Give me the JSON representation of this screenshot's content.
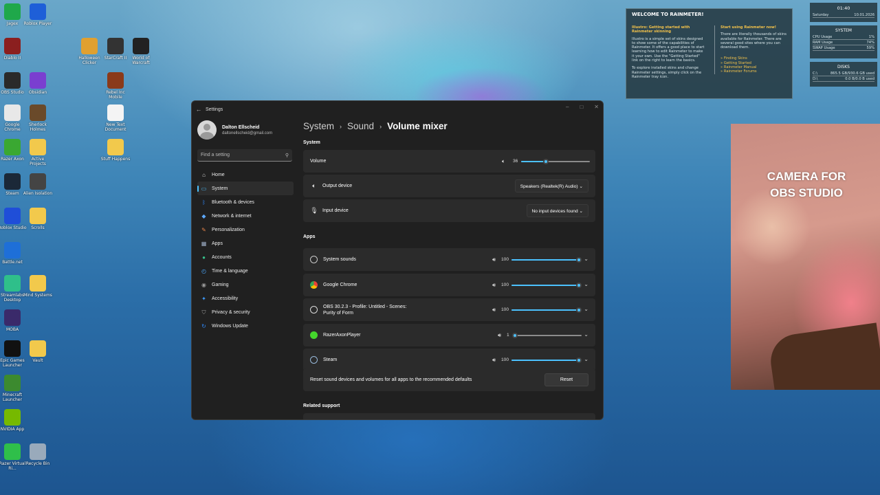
{
  "desktop": {
    "icons": [
      {
        "label": "Jagex"
      },
      {
        "label": "Roblox Player"
      },
      {
        "label": "Diablo II"
      },
      {
        "label": "Halloween Clicker"
      },
      {
        "label": "StarCraft II"
      },
      {
        "label": "World of Warcraft"
      },
      {
        "label": "OBS Studio"
      },
      {
        "label": "Obsidian"
      },
      {
        "label": "Rebel Inc Mobile"
      },
      {
        "label": "Google Chrome"
      },
      {
        "label": "Sherlock Holmes"
      },
      {
        "label": "New Text Document"
      },
      {
        "label": "Razer Axon"
      },
      {
        "label": "Active Projects"
      },
      {
        "label": "Stuff Happens"
      },
      {
        "label": "Steam"
      },
      {
        "label": "Alien Isolation"
      },
      {
        "label": "Roblox Studio"
      },
      {
        "label": "Scrolls"
      },
      {
        "label": "Battle.net"
      },
      {
        "label": "Streamlabs Desktop"
      },
      {
        "label": "Mind Systems"
      },
      {
        "label": "MOBA"
      },
      {
        "label": "Epic Games Launcher"
      },
      {
        "label": "Vault"
      },
      {
        "label": "Minecraft Launcher"
      },
      {
        "label": "NVIDIA App"
      },
      {
        "label": "Razer Virtual Ri..."
      },
      {
        "label": "Recycle Bin"
      }
    ]
  },
  "rainmeter": {
    "welcome_title": "WELCOME TO RAINMETER!",
    "left_heading": "Illustro: Getting started with Rainmeter skinning",
    "left_body": "Illustro is a simple set of skins designed to show some of the capabilities of Rainmeter. It offers a good place to start learning how to edit Rainmeter to make it your own. Use the \"Getting Started\" link on the right to learn the basics.",
    "left_body2": "To explore installed skins and change Rainmeter settings, simply click on the Rainmeter tray icon.",
    "right_heading": "Start using Rainmeter now!",
    "right_body": "There are literally thousands of skins available for Rainmeter. There are several good sites where you can download them.",
    "links": [
      "» Finding Skins",
      "» Getting Started",
      "» Rainmeter Manual",
      "» Rainmeter Forums"
    ],
    "clock": {
      "time": "01:40",
      "day": "Saturday",
      "date": "10.01.2026"
    },
    "system": {
      "title": "SYSTEM",
      "rows": [
        {
          "label": "CPU Usage",
          "value": "1%"
        },
        {
          "label": "RAM Usage",
          "value": "74%"
        },
        {
          "label": "SWAP Usage",
          "value": "59%"
        }
      ]
    },
    "disks": {
      "title": "DISKS",
      "rows": [
        {
          "label": "C:\\",
          "value": "865.5 GB/930.6 GB used"
        },
        {
          "label": "D:\\",
          "value": "0.0 B/0.0 B used"
        }
      ]
    }
  },
  "camera": {
    "label": "CAMERA FOR OBS STUDIO"
  },
  "settings": {
    "title": "Settings",
    "profile": {
      "name": "Dalton Ellscheid",
      "email": "daltonellscheid@gmail.com"
    },
    "search_placeholder": "Find a setting",
    "nav": [
      {
        "label": "Home",
        "icon": "home-icon",
        "color": "#dddddd"
      },
      {
        "label": "System",
        "icon": "monitor-icon",
        "color": "#4cc2ff"
      },
      {
        "label": "Bluetooth & devices",
        "icon": "bluetooth-icon",
        "color": "#2f8bff"
      },
      {
        "label": "Network & internet",
        "icon": "wifi-icon",
        "color": "#5ea9ff"
      },
      {
        "label": "Personalization",
        "icon": "brush-icon",
        "color": "#e8844a"
      },
      {
        "label": "Apps",
        "icon": "apps-icon",
        "color": "#9fb0c8"
      },
      {
        "label": "Accounts",
        "icon": "person-icon",
        "color": "#36c08a"
      },
      {
        "label": "Time & language",
        "icon": "globe-clock-icon",
        "color": "#4aa8ff"
      },
      {
        "label": "Gaming",
        "icon": "controller-icon",
        "color": "#9a9a9a"
      },
      {
        "label": "Accessibility",
        "icon": "accessibility-icon",
        "color": "#3e9cff"
      },
      {
        "label": "Privacy & security",
        "icon": "shield-icon",
        "color": "#9a9a9a"
      },
      {
        "label": "Windows Update",
        "icon": "update-icon",
        "color": "#2f8bff"
      }
    ],
    "breadcrumb": {
      "part1": "System",
      "part2": "Sound",
      "current": "Volume mixer"
    },
    "system_header": "System",
    "volume": {
      "label": "Volume",
      "value": "36",
      "level": 0.36
    },
    "output": {
      "label": "Output device",
      "value": "Speakers (Realtek(R) Audio)"
    },
    "input": {
      "label": "Input device",
      "value": "No input devices found"
    },
    "apps_header": "Apps",
    "apps": [
      {
        "name": "System sounds",
        "line2": "",
        "value": "100",
        "level": 1.0
      },
      {
        "name": "Google Chrome",
        "line2": "",
        "value": "100",
        "level": 1.0
      },
      {
        "name": "OBS 30.2.3 - Profile: Untitled - Scenes:",
        "line2": "Purity of Form",
        "value": "100",
        "level": 1.0
      },
      {
        "name": "RazerAxonPlayer",
        "line2": "",
        "value": "1",
        "level": 0.01
      },
      {
        "name": "Steam",
        "line2": "",
        "value": "100",
        "level": 1.0
      }
    ],
    "reset_text": "Reset sound devices and volumes for all apps to the recommended defaults",
    "reset_button": "Reset",
    "related_header": "Related support"
  }
}
